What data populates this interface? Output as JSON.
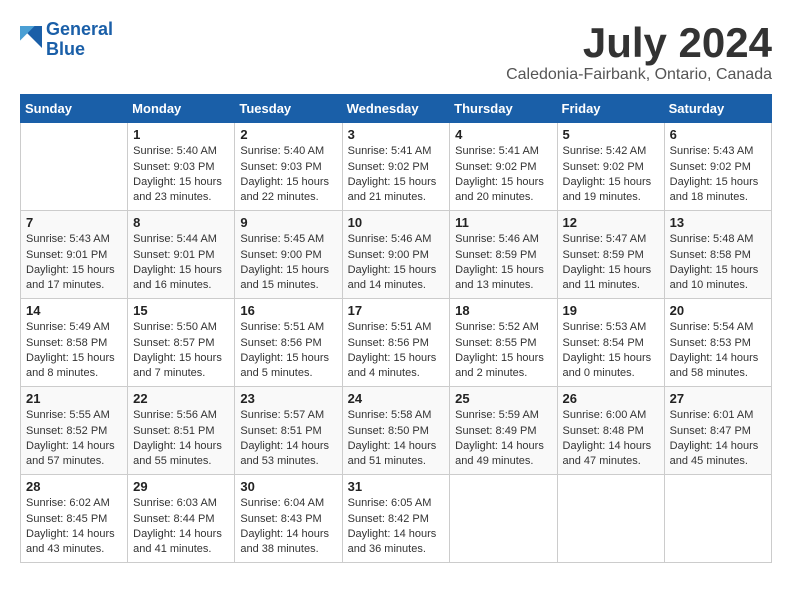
{
  "header": {
    "logo_line1": "General",
    "logo_line2": "Blue",
    "month_title": "July 2024",
    "subtitle": "Caledonia-Fairbank, Ontario, Canada"
  },
  "days_of_week": [
    "Sunday",
    "Monday",
    "Tuesday",
    "Wednesday",
    "Thursday",
    "Friday",
    "Saturday"
  ],
  "weeks": [
    [
      {
        "day": "",
        "sunrise": "",
        "sunset": "",
        "daylight": ""
      },
      {
        "day": "1",
        "sunrise": "Sunrise: 5:40 AM",
        "sunset": "Sunset: 9:03 PM",
        "daylight": "Daylight: 15 hours and 23 minutes."
      },
      {
        "day": "2",
        "sunrise": "Sunrise: 5:40 AM",
        "sunset": "Sunset: 9:03 PM",
        "daylight": "Daylight: 15 hours and 22 minutes."
      },
      {
        "day": "3",
        "sunrise": "Sunrise: 5:41 AM",
        "sunset": "Sunset: 9:02 PM",
        "daylight": "Daylight: 15 hours and 21 minutes."
      },
      {
        "day": "4",
        "sunrise": "Sunrise: 5:41 AM",
        "sunset": "Sunset: 9:02 PM",
        "daylight": "Daylight: 15 hours and 20 minutes."
      },
      {
        "day": "5",
        "sunrise": "Sunrise: 5:42 AM",
        "sunset": "Sunset: 9:02 PM",
        "daylight": "Daylight: 15 hours and 19 minutes."
      },
      {
        "day": "6",
        "sunrise": "Sunrise: 5:43 AM",
        "sunset": "Sunset: 9:02 PM",
        "daylight": "Daylight: 15 hours and 18 minutes."
      }
    ],
    [
      {
        "day": "7",
        "sunrise": "Sunrise: 5:43 AM",
        "sunset": "Sunset: 9:01 PM",
        "daylight": "Daylight: 15 hours and 17 minutes."
      },
      {
        "day": "8",
        "sunrise": "Sunrise: 5:44 AM",
        "sunset": "Sunset: 9:01 PM",
        "daylight": "Daylight: 15 hours and 16 minutes."
      },
      {
        "day": "9",
        "sunrise": "Sunrise: 5:45 AM",
        "sunset": "Sunset: 9:00 PM",
        "daylight": "Daylight: 15 hours and 15 minutes."
      },
      {
        "day": "10",
        "sunrise": "Sunrise: 5:46 AM",
        "sunset": "Sunset: 9:00 PM",
        "daylight": "Daylight: 15 hours and 14 minutes."
      },
      {
        "day": "11",
        "sunrise": "Sunrise: 5:46 AM",
        "sunset": "Sunset: 8:59 PM",
        "daylight": "Daylight: 15 hours and 13 minutes."
      },
      {
        "day": "12",
        "sunrise": "Sunrise: 5:47 AM",
        "sunset": "Sunset: 8:59 PM",
        "daylight": "Daylight: 15 hours and 11 minutes."
      },
      {
        "day": "13",
        "sunrise": "Sunrise: 5:48 AM",
        "sunset": "Sunset: 8:58 PM",
        "daylight": "Daylight: 15 hours and 10 minutes."
      }
    ],
    [
      {
        "day": "14",
        "sunrise": "Sunrise: 5:49 AM",
        "sunset": "Sunset: 8:58 PM",
        "daylight": "Daylight: 15 hours and 8 minutes."
      },
      {
        "day": "15",
        "sunrise": "Sunrise: 5:50 AM",
        "sunset": "Sunset: 8:57 PM",
        "daylight": "Daylight: 15 hours and 7 minutes."
      },
      {
        "day": "16",
        "sunrise": "Sunrise: 5:51 AM",
        "sunset": "Sunset: 8:56 PM",
        "daylight": "Daylight: 15 hours and 5 minutes."
      },
      {
        "day": "17",
        "sunrise": "Sunrise: 5:51 AM",
        "sunset": "Sunset: 8:56 PM",
        "daylight": "Daylight: 15 hours and 4 minutes."
      },
      {
        "day": "18",
        "sunrise": "Sunrise: 5:52 AM",
        "sunset": "Sunset: 8:55 PM",
        "daylight": "Daylight: 15 hours and 2 minutes."
      },
      {
        "day": "19",
        "sunrise": "Sunrise: 5:53 AM",
        "sunset": "Sunset: 8:54 PM",
        "daylight": "Daylight: 15 hours and 0 minutes."
      },
      {
        "day": "20",
        "sunrise": "Sunrise: 5:54 AM",
        "sunset": "Sunset: 8:53 PM",
        "daylight": "Daylight: 14 hours and 58 minutes."
      }
    ],
    [
      {
        "day": "21",
        "sunrise": "Sunrise: 5:55 AM",
        "sunset": "Sunset: 8:52 PM",
        "daylight": "Daylight: 14 hours and 57 minutes."
      },
      {
        "day": "22",
        "sunrise": "Sunrise: 5:56 AM",
        "sunset": "Sunset: 8:51 PM",
        "daylight": "Daylight: 14 hours and 55 minutes."
      },
      {
        "day": "23",
        "sunrise": "Sunrise: 5:57 AM",
        "sunset": "Sunset: 8:51 PM",
        "daylight": "Daylight: 14 hours and 53 minutes."
      },
      {
        "day": "24",
        "sunrise": "Sunrise: 5:58 AM",
        "sunset": "Sunset: 8:50 PM",
        "daylight": "Daylight: 14 hours and 51 minutes."
      },
      {
        "day": "25",
        "sunrise": "Sunrise: 5:59 AM",
        "sunset": "Sunset: 8:49 PM",
        "daylight": "Daylight: 14 hours and 49 minutes."
      },
      {
        "day": "26",
        "sunrise": "Sunrise: 6:00 AM",
        "sunset": "Sunset: 8:48 PM",
        "daylight": "Daylight: 14 hours and 47 minutes."
      },
      {
        "day": "27",
        "sunrise": "Sunrise: 6:01 AM",
        "sunset": "Sunset: 8:47 PM",
        "daylight": "Daylight: 14 hours and 45 minutes."
      }
    ],
    [
      {
        "day": "28",
        "sunrise": "Sunrise: 6:02 AM",
        "sunset": "Sunset: 8:45 PM",
        "daylight": "Daylight: 14 hours and 43 minutes."
      },
      {
        "day": "29",
        "sunrise": "Sunrise: 6:03 AM",
        "sunset": "Sunset: 8:44 PM",
        "daylight": "Daylight: 14 hours and 41 minutes."
      },
      {
        "day": "30",
        "sunrise": "Sunrise: 6:04 AM",
        "sunset": "Sunset: 8:43 PM",
        "daylight": "Daylight: 14 hours and 38 minutes."
      },
      {
        "day": "31",
        "sunrise": "Sunrise: 6:05 AM",
        "sunset": "Sunset: 8:42 PM",
        "daylight": "Daylight: 14 hours and 36 minutes."
      },
      {
        "day": "",
        "sunrise": "",
        "sunset": "",
        "daylight": ""
      },
      {
        "day": "",
        "sunrise": "",
        "sunset": "",
        "daylight": ""
      },
      {
        "day": "",
        "sunrise": "",
        "sunset": "",
        "daylight": ""
      }
    ]
  ]
}
